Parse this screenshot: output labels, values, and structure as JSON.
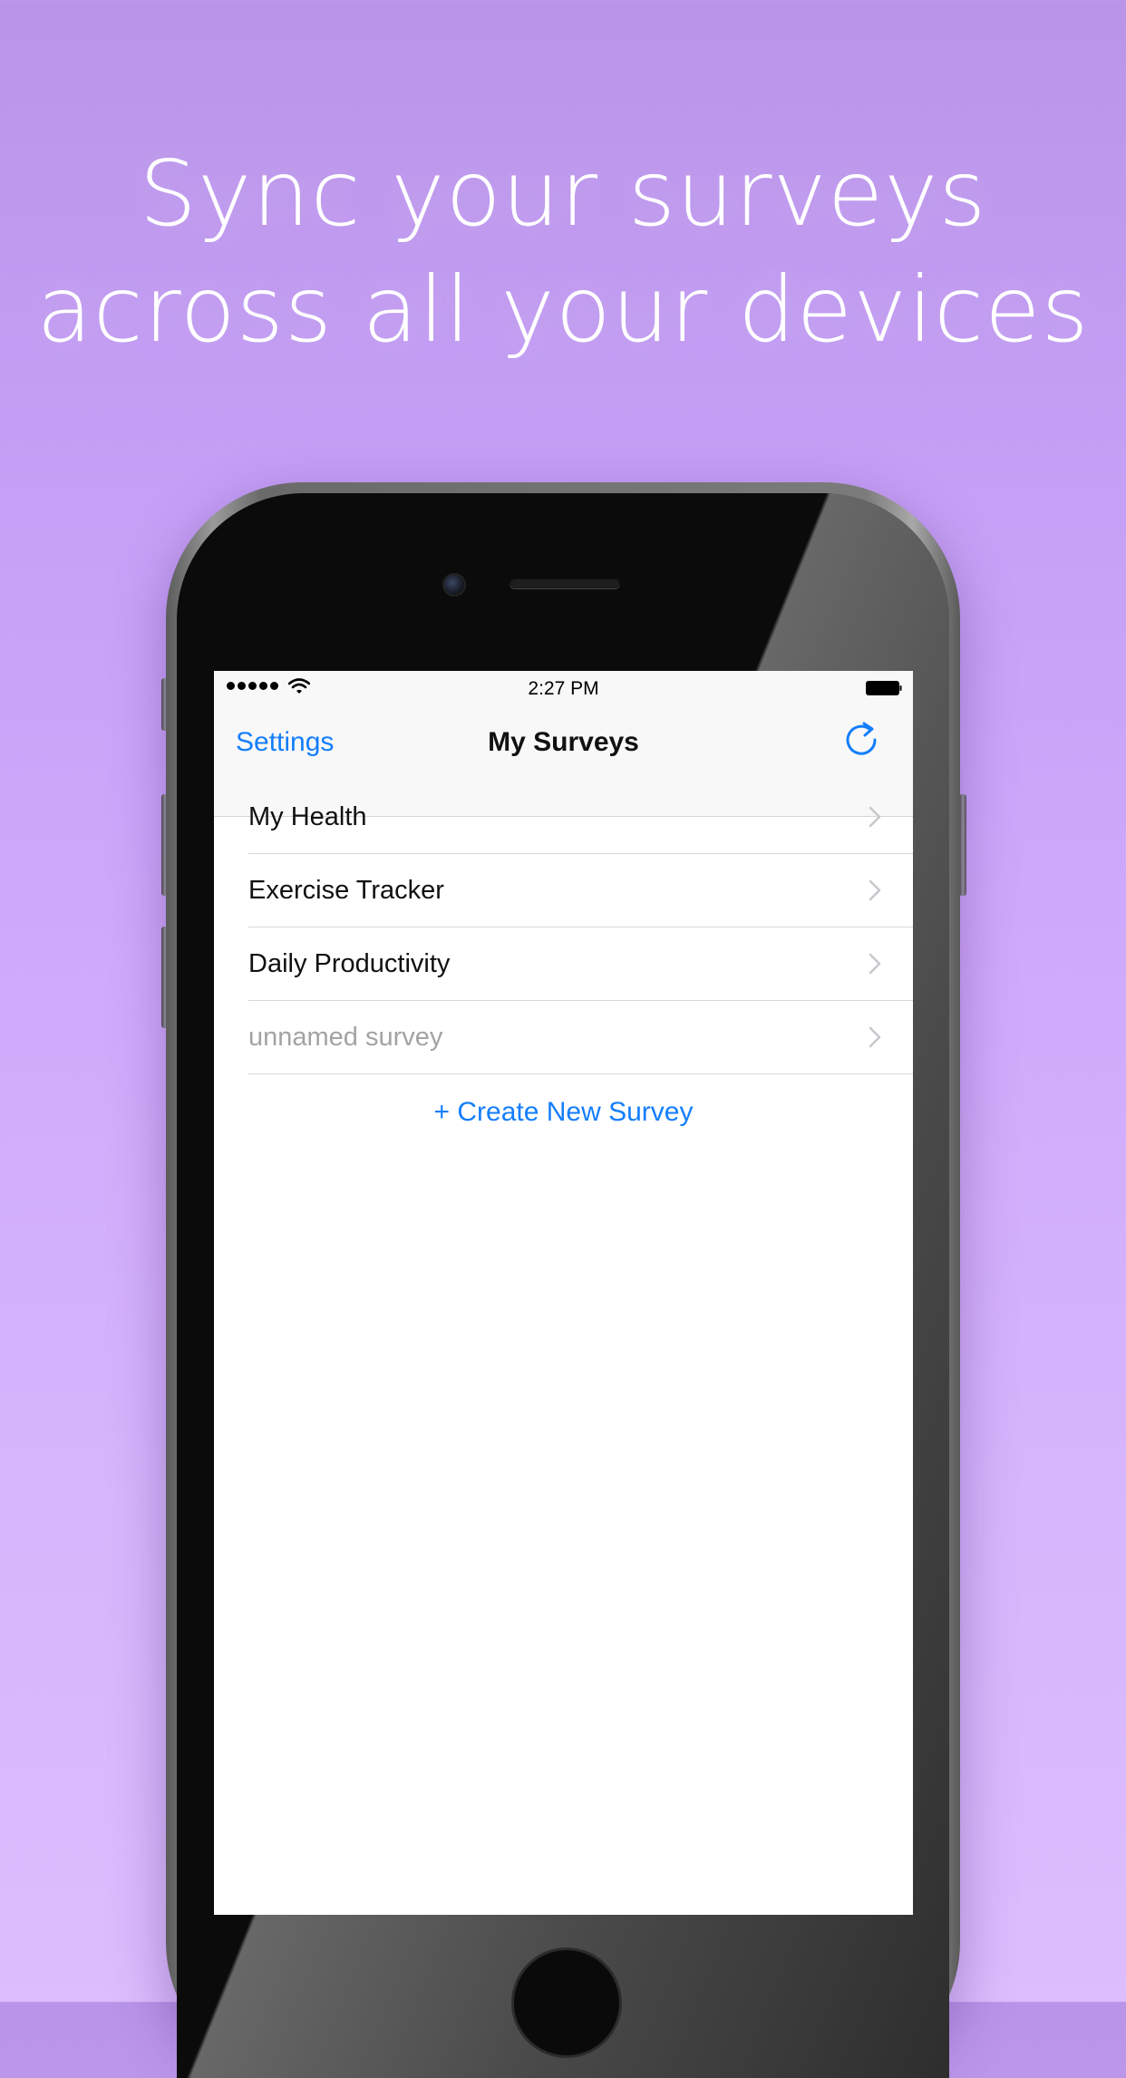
{
  "headline": {
    "line1": "Sync your surveys",
    "line2": "across all your devices"
  },
  "status_bar": {
    "time": "2:27 PM",
    "signal_icon": "signal-dots-icon",
    "wifi_icon": "wifi-icon",
    "battery_icon": "battery-icon"
  },
  "nav": {
    "left_label": "Settings",
    "title": "My Surveys",
    "right_icon": "refresh-icon"
  },
  "surveys": [
    {
      "label": "My Health",
      "placeholder": false
    },
    {
      "label": "Exercise Tracker",
      "placeholder": false
    },
    {
      "label": "Daily Productivity",
      "placeholder": false
    },
    {
      "label": "unnamed survey",
      "placeholder": true
    }
  ],
  "create_label": "+ Create New Survey",
  "colors": {
    "accent": "#147efb",
    "background_top": "#b994e8",
    "background_bottom": "#dcbdfd",
    "placeholder_text": "#a3a3a3"
  }
}
